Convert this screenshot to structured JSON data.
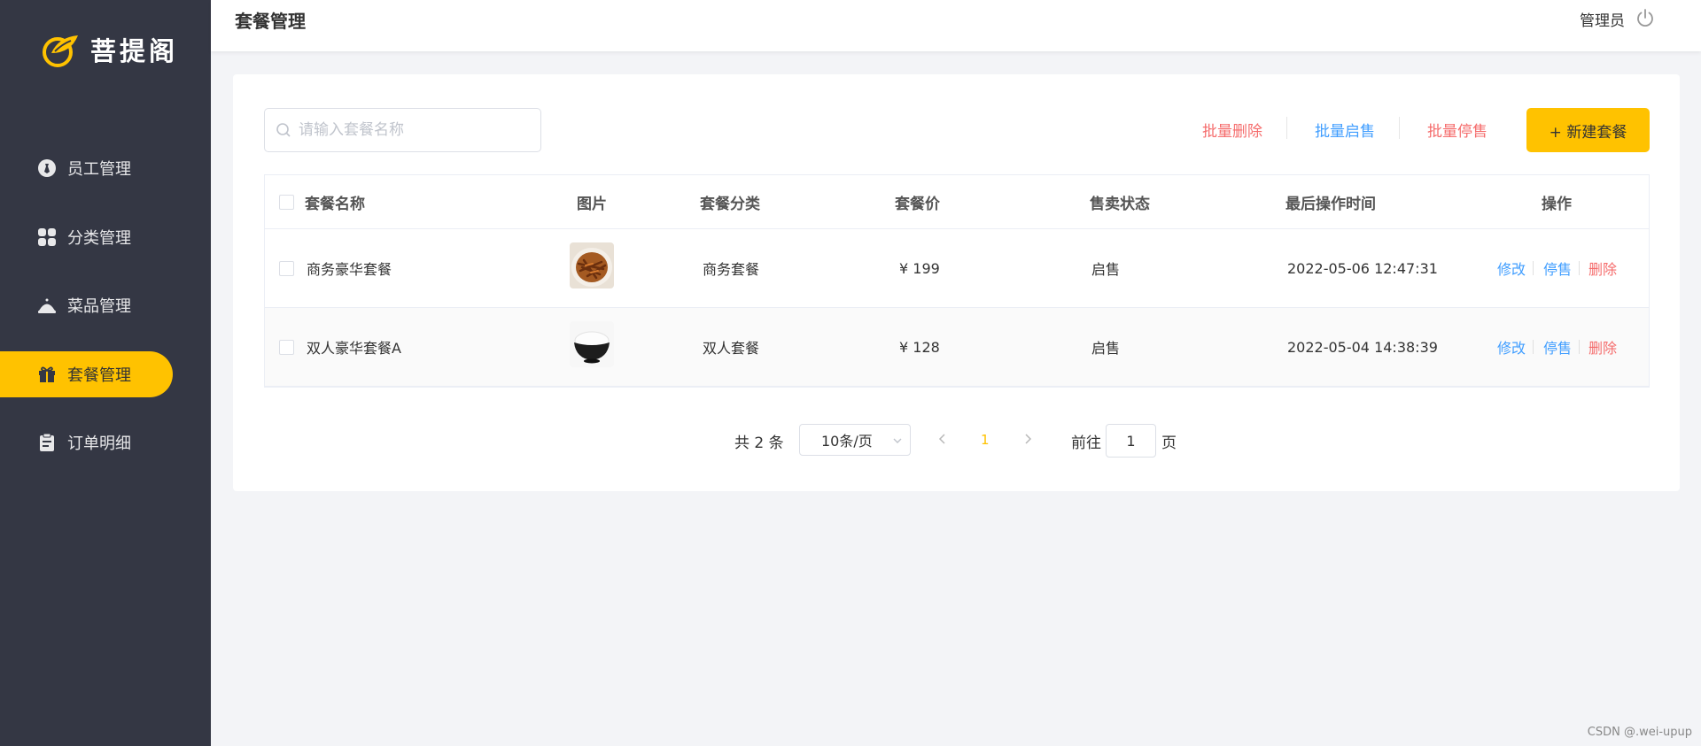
{
  "brand": {
    "name": "菩提阁",
    "accent": "#ffc200",
    "sidebar_bg": "#343744"
  },
  "sidebar": {
    "items": [
      {
        "label": "员工管理",
        "icon": "employee-icon",
        "active": false
      },
      {
        "label": "分类管理",
        "icon": "category-icon",
        "active": false
      },
      {
        "label": "菜品管理",
        "icon": "dish-icon",
        "active": false
      },
      {
        "label": "套餐管理",
        "icon": "gift-icon",
        "active": true
      },
      {
        "label": "订单明细",
        "icon": "clipboard-icon",
        "active": false
      }
    ]
  },
  "header": {
    "title": "套餐管理",
    "user": "管理员",
    "logout_icon": "power-icon"
  },
  "toolbar": {
    "search_placeholder": "请输入套餐名称",
    "batch_delete": "批量删除",
    "batch_start": "批量启售",
    "batch_stop": "批量停售",
    "new_button": "+ 新建套餐"
  },
  "table": {
    "columns": [
      "套餐名称",
      "图片",
      "套餐分类",
      "套餐价",
      "售卖状态",
      "最后操作时间",
      "操作"
    ],
    "rows": [
      {
        "name": "商务豪华套餐",
        "image": "noodles-dish",
        "category": "商务套餐",
        "price": "¥ 199",
        "status": "启售",
        "updated": "2022-05-06 12:47:31",
        "actions": [
          "修改",
          "停售",
          "删除"
        ]
      },
      {
        "name": "双人豪华套餐A",
        "image": "rice-bowl",
        "category": "双人套餐",
        "price": "¥ 128",
        "status": "启售",
        "updated": "2022-05-04 14:38:39",
        "actions": [
          "修改",
          "停售",
          "删除"
        ]
      }
    ]
  },
  "pagination": {
    "total_text": "共 2 条",
    "page_size": "10条/页",
    "current": "1",
    "goto_label": "前往",
    "goto_value": "1",
    "page_label": "页"
  },
  "watermark": "CSDN @.wei-upup"
}
